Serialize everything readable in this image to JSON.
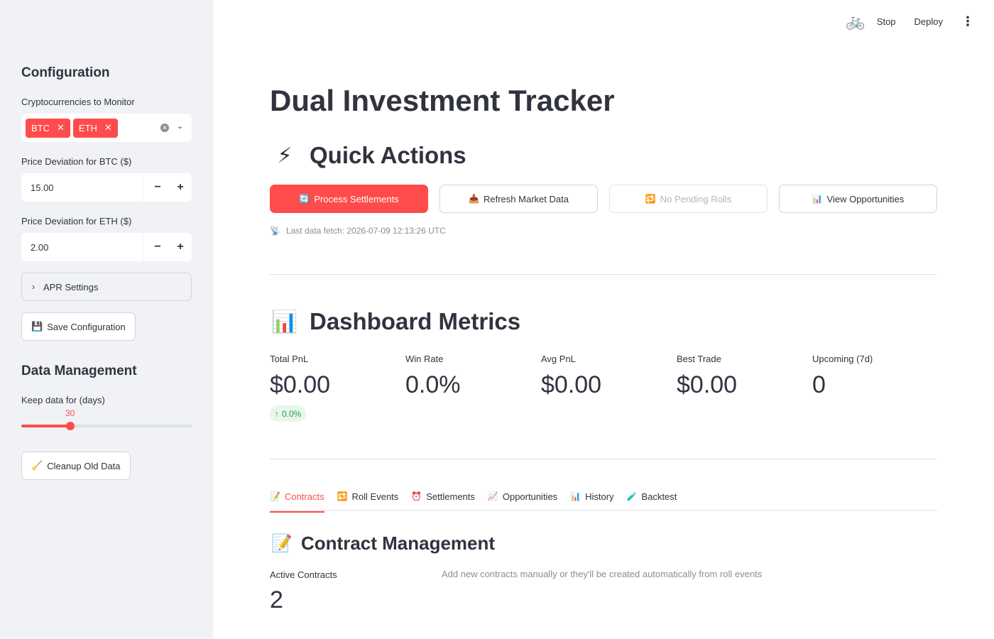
{
  "sidebar": {
    "configuration_heading": "Configuration",
    "cryptos_label": "Cryptocurrencies to Monitor",
    "cryptos_selected": [
      "BTC",
      "ETH"
    ],
    "btc_deviation_label": "Price Deviation for BTC ($)",
    "btc_deviation_value": "15.00",
    "eth_deviation_label": "Price Deviation for ETH ($)",
    "eth_deviation_value": "2.00",
    "apr_settings_label": "APR Settings",
    "save_config_label": "Save Configuration",
    "data_mgmt_heading": "Data Management",
    "keep_days_label": "Keep data for (days)",
    "keep_days_value": "30",
    "keep_days_fraction": 0.287,
    "cleanup_label": "Cleanup Old Data"
  },
  "topbar": {
    "stop_label": "Stop",
    "deploy_label": "Deploy"
  },
  "main": {
    "title": "Dual Investment Tracker",
    "quick_actions_heading": "Quick Actions",
    "quick_actions": [
      {
        "label": "Process Settlements",
        "icon": "arrows-cycle-icon"
      },
      {
        "label": "Refresh Market Data",
        "icon": "inbox-tray-icon"
      },
      {
        "label": "No Pending Rolls",
        "icon": "repeat-icon"
      },
      {
        "label": "View Opportunities",
        "icon": "bar-chart-icon"
      }
    ],
    "last_fetch": "Last data fetch: 2026-07-09 12:13:26 UTC",
    "dashboard_heading": "Dashboard Metrics",
    "metrics": [
      {
        "label": "Total PnL",
        "value": "$0.00"
      },
      {
        "label": "Win Rate",
        "value": "0.0%"
      },
      {
        "label": "Avg PnL",
        "value": "$0.00"
      },
      {
        "label": "Best Trade",
        "value": "$0.00"
      },
      {
        "label": "Upcoming (7d)",
        "value": "0"
      }
    ],
    "total_pnl_delta": "0.0%",
    "tabs": [
      {
        "label": "Contracts",
        "icon": "memo-icon"
      },
      {
        "label": "Roll Events",
        "icon": "repeat-icon"
      },
      {
        "label": "Settlements",
        "icon": "alarm-clock-icon"
      },
      {
        "label": "Opportunities",
        "icon": "line-chart-icon"
      },
      {
        "label": "History",
        "icon": "bar-chart-icon"
      },
      {
        "label": "Backtest",
        "icon": "test-tube-icon"
      }
    ],
    "contract_heading": "Contract Management",
    "active_contracts_label": "Active Contracts",
    "active_contracts_value": "2",
    "contracts_hint": "Add new contracts manually or they'll be created automatically from roll events"
  },
  "colors": {
    "accent": "#ff4b4b",
    "sidebar_bg": "#f0f2f6",
    "text": "#31333f",
    "delta_green": "#21a045"
  }
}
